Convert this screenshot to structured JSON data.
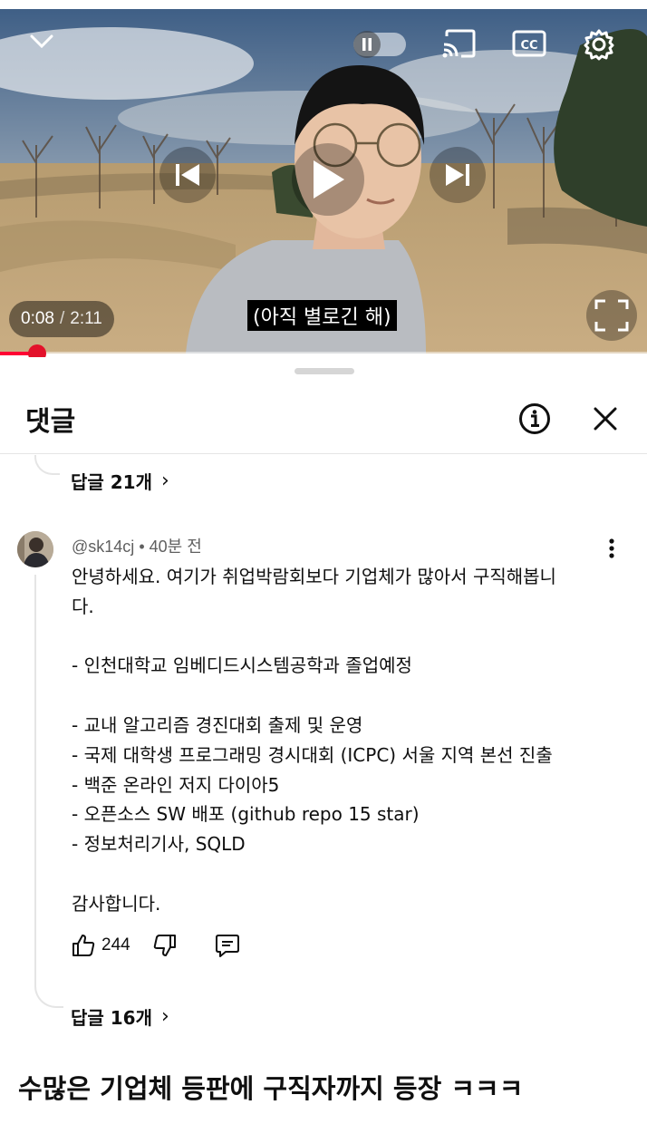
{
  "player": {
    "current_time": "0:08",
    "separator": "/",
    "duration": "2:11",
    "subtitle": "(아직 별로긴 해)",
    "progress_fraction": 0.058
  },
  "icons": {
    "collapse": "chevron-down-icon",
    "autoplay": "pause-toggle-icon",
    "cast": "cast-icon",
    "captions": "cc-icon",
    "settings": "gear-icon",
    "previous": "skip-previous-icon",
    "play": "play-icon",
    "next": "skip-next-icon",
    "fullscreen": "fullscreen-icon",
    "info": "info-icon",
    "close": "close-icon",
    "more": "more-vert-icon",
    "like": "thumbs-up-icon",
    "dislike": "thumbs-down-icon",
    "reply": "comment-icon"
  },
  "captions_label": "CC",
  "comments_panel": {
    "title": "댓글",
    "prev_replies": "답글 21개",
    "comment": {
      "author": "@sk14cj",
      "dot": "•",
      "time": "40분 전",
      "text": "안녕하세요. 여기가 취업박람회보다 기업체가 많아서 구직해봅니\n다.\n\n- 인천대학교 임베디드시스템공학과 졸업예정\n\n- 교내 알고리즘 경진대회 출제 및 운영\n- 국제 대학생 프로그래밍 경시대회 (ICPC) 서울 지역 본선 진출\n- 백준 온라인 저지 다이아5\n- 오픈소스 SW 배포 (github repo 15 star)\n- 정보처리기사, SQLD\n\n감사합니다.",
      "likes": "244",
      "replies": "답글 16개"
    }
  },
  "caption": "수많은 기업체 등판에 구직자까지 등장 ㅋㅋㅋ",
  "colors": {
    "progress": "#ff0033",
    "scrubber": "#e3112a",
    "text": "#0f0f0f",
    "meta": "#606060"
  }
}
